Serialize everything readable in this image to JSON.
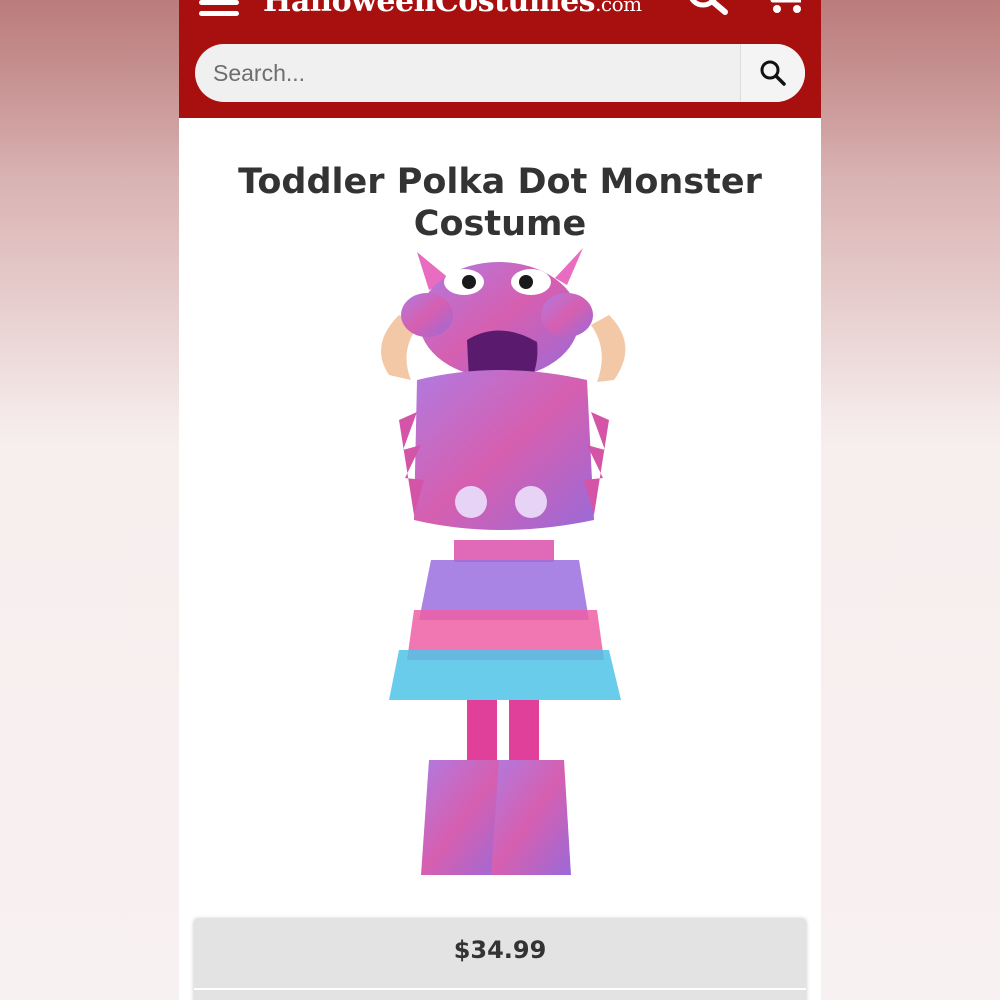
{
  "header": {
    "logo_main": "HalloweenCostumes",
    "logo_tld": ".com",
    "icons": [
      "menu-icon",
      "search-icon",
      "cart-icon"
    ]
  },
  "search": {
    "placeholder": "Search..."
  },
  "product": {
    "title": "Toddler Polka Dot Monster Costume",
    "image_alt": "Toddler Polka Dot Monster Costume",
    "price": "$34.99"
  },
  "colors": {
    "header_bg": "#a80f0f",
    "costume_purple": "#9b59d0",
    "costume_pink": "#e0409a",
    "costume_blue": "#4fc3e8"
  }
}
